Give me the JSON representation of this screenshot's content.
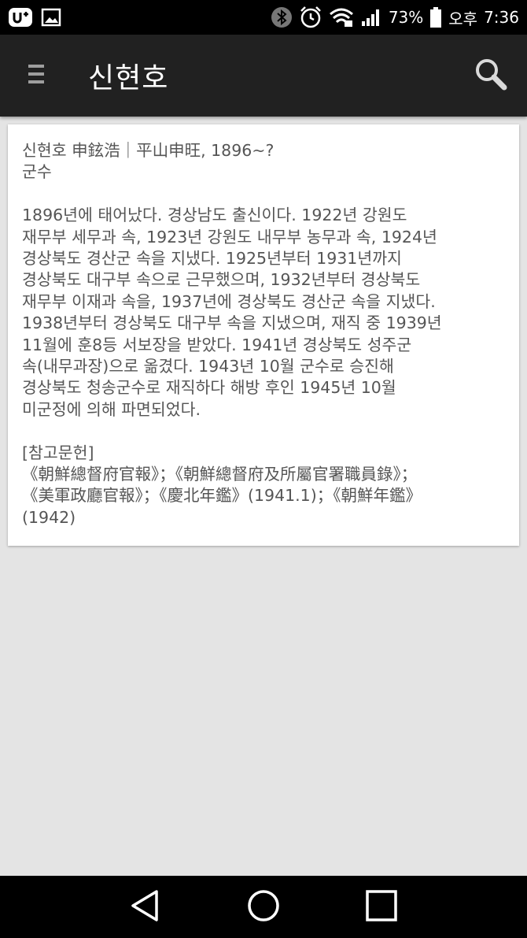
{
  "status_bar": {
    "battery_percent": "73%",
    "ampm": "오후",
    "time": "7:36",
    "icons": [
      "uplus-icon",
      "image-icon",
      "bluetooth-icon",
      "alarm-icon",
      "wifi-icon",
      "signal-icon",
      "battery-icon"
    ]
  },
  "app_bar": {
    "title": "신현호",
    "menu_icon": "menu-icon",
    "search_icon": "search-icon"
  },
  "entry": {
    "heading": "신현호 申鉉浩｜平山申旺, 1896~?",
    "role": "군수",
    "body": "1896년에 태어났다. 경상남도 출신이다. 1922년 강원도\n재무부 세무과 속, 1923년 강원도 내무부 농무과 속, 1924년\n경상북도 경산군 속을 지냈다. 1925년부터 1931년까지\n경상북도 대구부 속으로 근무했으며, 1932년부터 경상북도\n재무부 이재과 속을, 1937년에 경상북도 경산군 속을 지냈다.\n1938년부터 경상북도 대구부 속을 지냈으며, 재직 중 1939년\n11월에 훈8등 서보장을 받았다. 1941년 경상북도 성주군\n속(내무과장)으로 옮겼다. 1943년 10월 군수로 승진해\n경상북도 청송군수로 재직하다 해방 후인 1945년 10월\n미군정에 의해 파면되었다.",
    "references_label": "[참고문헌]",
    "references": "《朝鮮總督府官報》；《朝鮮總督府及所屬官署職員錄》；\n《美軍政廳官報》；《慶北年鑑》(1941.1)；《朝鮮年鑑》\n(1942)"
  },
  "nav_bar": {
    "icons": [
      "back-icon",
      "home-icon",
      "recents-icon"
    ]
  }
}
